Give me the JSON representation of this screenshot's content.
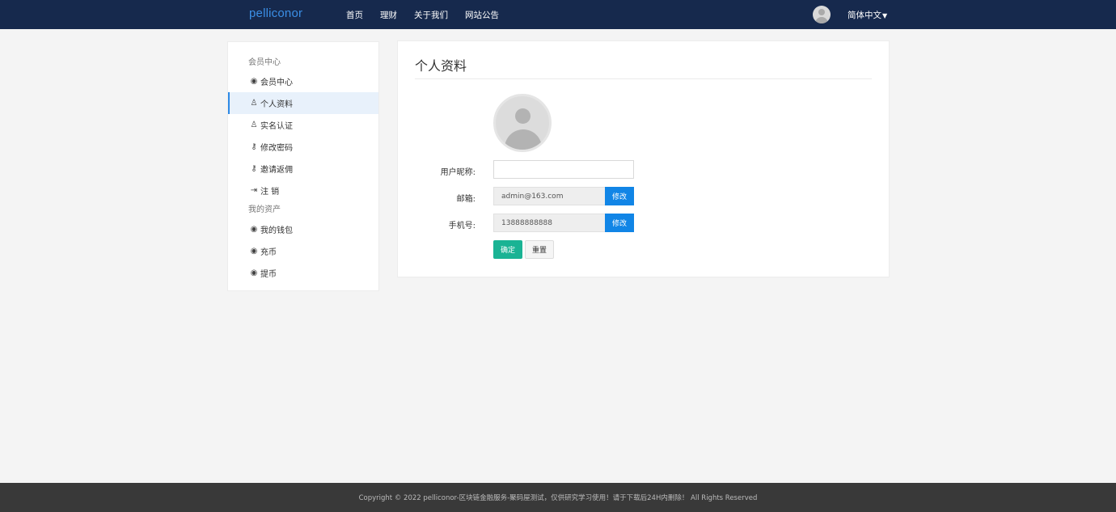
{
  "header": {
    "brand": "pelliconor",
    "nav": [
      "首页",
      "理财",
      "关于我们",
      "网站公告"
    ],
    "language": "简体中文"
  },
  "sidebar": {
    "group1": "会员中心",
    "items1": [
      {
        "label": "会员中心",
        "icon": "user-circle-icon"
      },
      {
        "label": "个人资料",
        "icon": "user-outline-icon"
      },
      {
        "label": "实名认证",
        "icon": "user-outline-icon"
      },
      {
        "label": "修改密码",
        "icon": "key-icon"
      },
      {
        "label": "邀请返佣",
        "icon": "key-icon"
      },
      {
        "label": "注 销",
        "icon": "sign-out-icon"
      }
    ],
    "group2": "我的资产",
    "items2": [
      {
        "label": "我的钱包",
        "icon": "user-circle-icon"
      },
      {
        "label": "充币",
        "icon": "user-circle-icon"
      },
      {
        "label": "提币",
        "icon": "user-circle-icon"
      }
    ]
  },
  "panel": {
    "title": "个人资料",
    "nickname_label": "用户昵称:",
    "nickname_value": "",
    "email_label": "邮箱:",
    "email_value": "admin@163.com",
    "phone_label": "手机号:",
    "phone_value": "13888888888",
    "modify_label": "修改",
    "ok_label": "确定",
    "reset_label": "重置"
  },
  "footer": {
    "text": "Copyright © 2022 pelliconor-区块链金融服务-聚码屋测试，仅供研究学习使用！请于下载后24H内删除！ All Rights Reserved"
  },
  "colors": {
    "header_bg": "#16294d",
    "brand": "#3b8fe6",
    "primary_button": "#1185e6",
    "confirm_button": "#1ab394",
    "footer_bg": "#393939"
  }
}
